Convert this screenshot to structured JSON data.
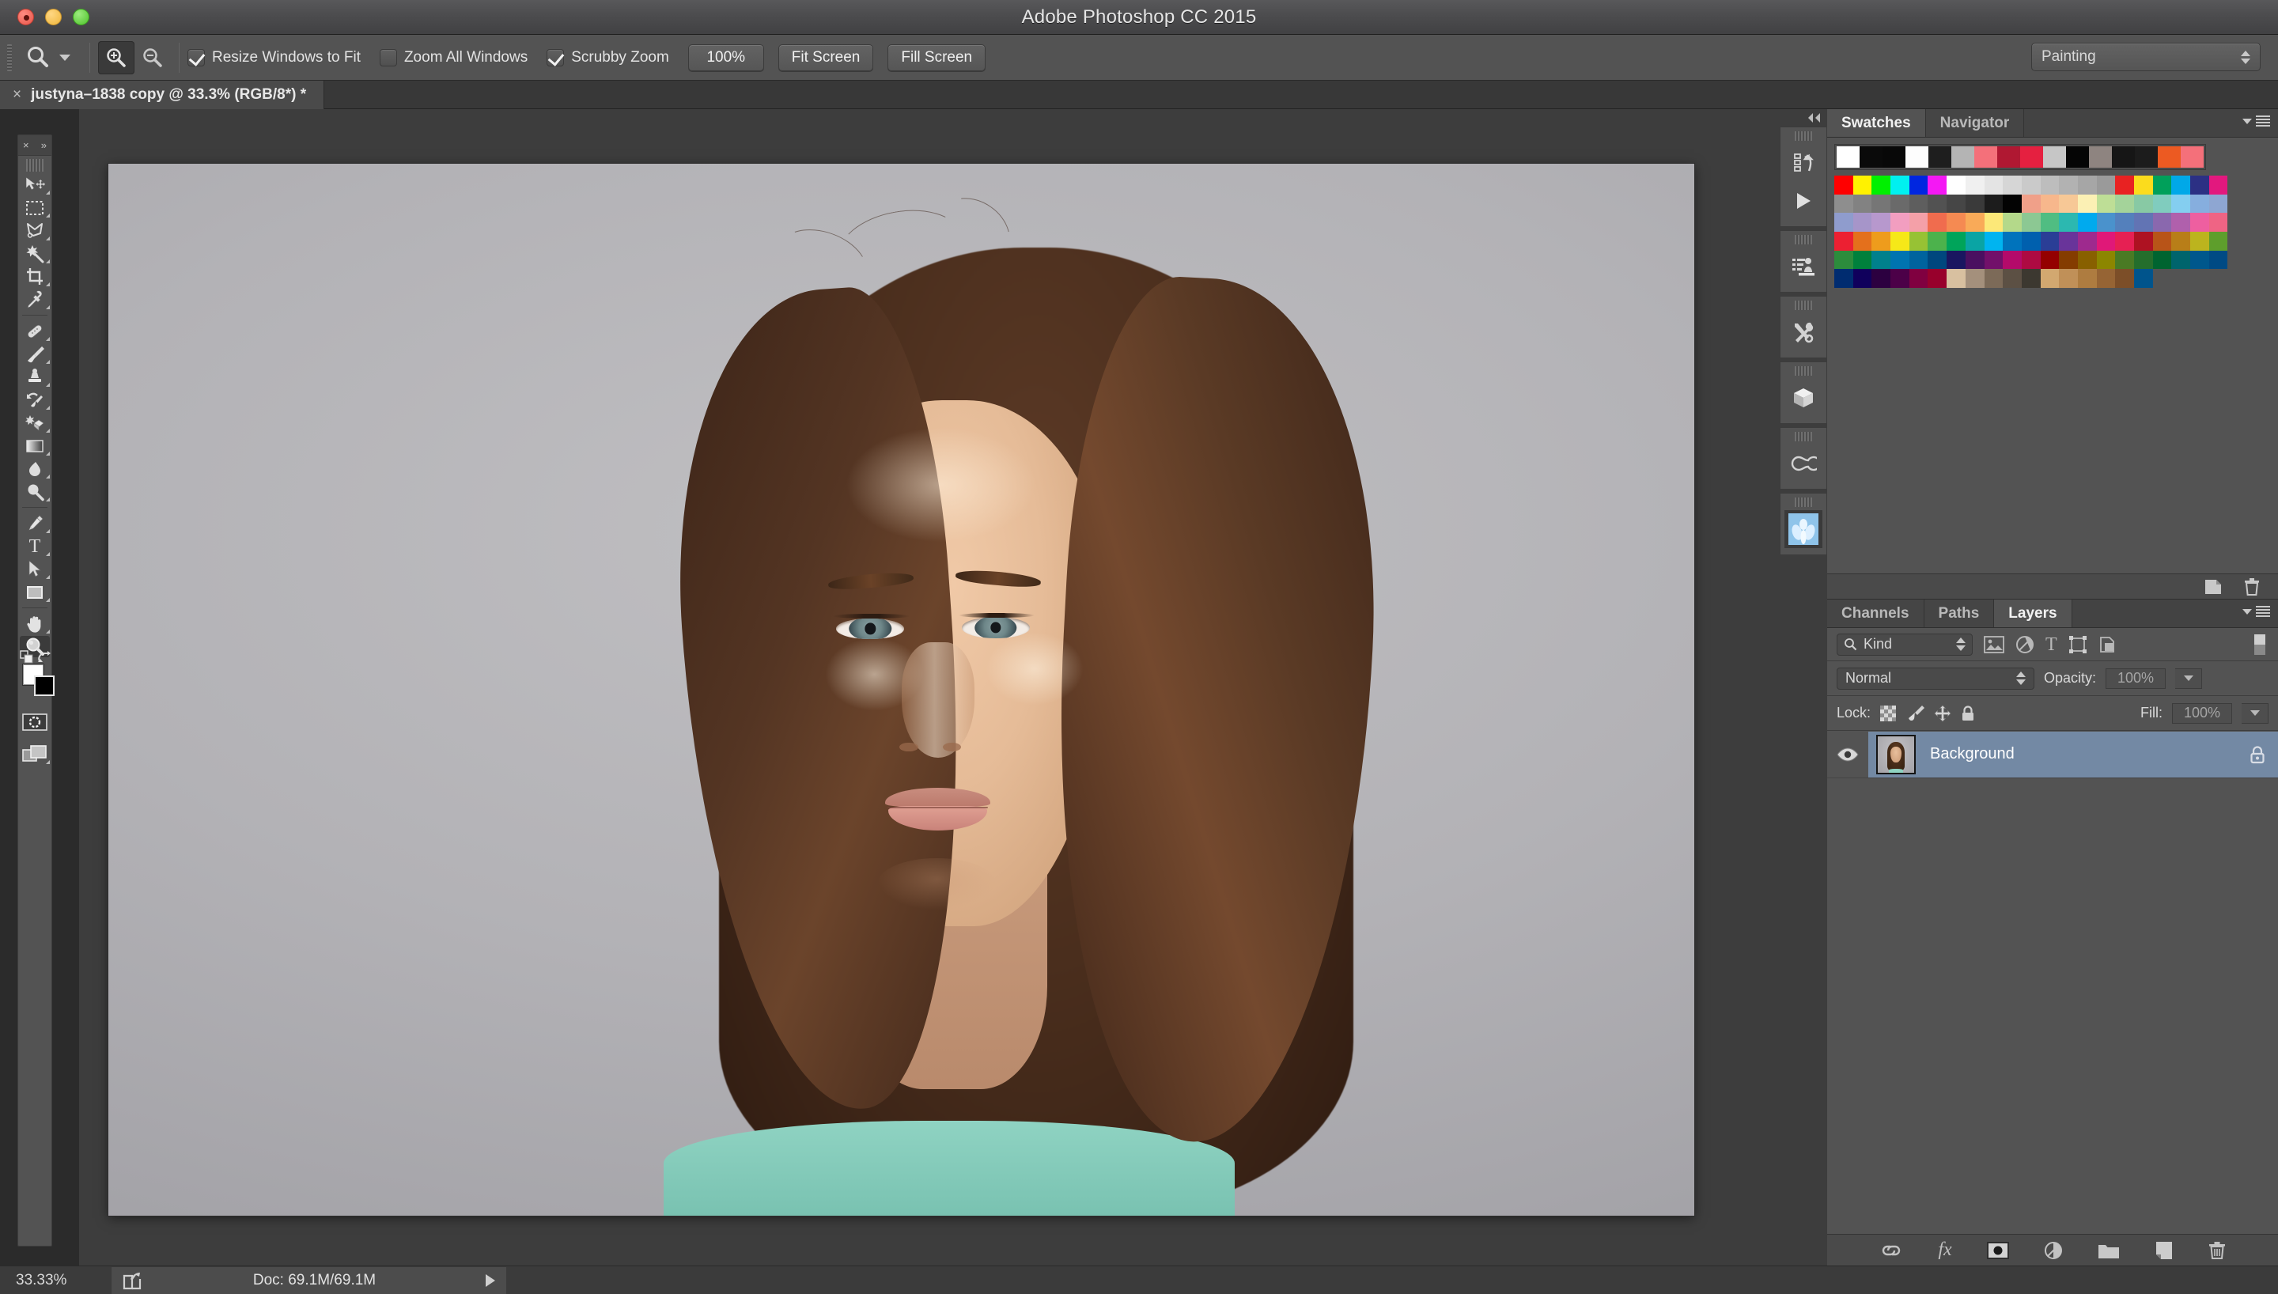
{
  "window": {
    "title": "Adobe Photoshop CC 2015",
    "traffic": {
      "close": "close-button",
      "minimize": "minimize-button",
      "maximize": "maximize-button"
    }
  },
  "options_bar": {
    "tool_preset_icon": "zoom-tool-icon",
    "zoom_in_icon": "zoom-in-icon",
    "zoom_out_icon": "zoom-out-icon",
    "checkboxes": [
      {
        "label": "Resize Windows to Fit",
        "checked": true
      },
      {
        "label": "Zoom All Windows",
        "checked": false
      },
      {
        "label": "Scrubby Zoom",
        "checked": true
      }
    ],
    "buttons": [
      "100%",
      "Fit Screen",
      "Fill Screen"
    ],
    "workspace": "Painting"
  },
  "document_tab": {
    "close": "×",
    "title": "justyna–1838 copy @ 33.3% (RGB/8*) *"
  },
  "toolbar": {
    "close_glyph": "×",
    "expand_glyph": "»",
    "tools": [
      {
        "name": "move-tool",
        "selected": false,
        "has_submenu": true
      },
      {
        "name": "rectangular-marquee-tool",
        "selected": false,
        "has_submenu": true
      },
      {
        "name": "lasso-tool",
        "selected": false,
        "has_submenu": true
      },
      {
        "name": "magic-wand-tool",
        "selected": false,
        "has_submenu": true
      },
      {
        "name": "crop-tool",
        "selected": false,
        "has_submenu": true
      },
      {
        "name": "eyedropper-tool",
        "selected": false,
        "has_submenu": true
      },
      {
        "name": "spot-healing-brush-tool",
        "selected": false,
        "has_submenu": true
      },
      {
        "name": "brush-tool",
        "selected": false,
        "has_submenu": true
      },
      {
        "name": "clone-stamp-tool",
        "selected": false,
        "has_submenu": true
      },
      {
        "name": "history-brush-tool",
        "selected": false,
        "has_submenu": true
      },
      {
        "name": "eraser-tool",
        "selected": false,
        "has_submenu": true
      },
      {
        "name": "gradient-tool",
        "selected": false,
        "has_submenu": true
      },
      {
        "name": "blur-tool",
        "selected": false,
        "has_submenu": true
      },
      {
        "name": "dodge-tool",
        "selected": false,
        "has_submenu": true
      },
      {
        "name": "pen-tool",
        "selected": false,
        "has_submenu": true
      },
      {
        "name": "type-tool",
        "selected": false,
        "has_submenu": true
      },
      {
        "name": "path-selection-tool",
        "selected": false,
        "has_submenu": true
      },
      {
        "name": "rectangle-tool",
        "selected": false,
        "has_submenu": true
      },
      {
        "name": "hand-tool",
        "selected": false,
        "has_submenu": true
      },
      {
        "name": "zoom-tool",
        "selected": true,
        "has_submenu": false
      }
    ],
    "foreground_color": "#ffffff",
    "background_color": "#000000",
    "quick_mask_icon": "quick-mask-icon",
    "screen_mode_icon": "screen-mode-icon"
  },
  "icon_dock": {
    "collapse_glyph": "◀◀",
    "groups": [
      {
        "items": [
          "history-icon",
          "actions-play-icon"
        ]
      },
      {
        "items": [
          "tool-presets-icon"
        ]
      },
      {
        "items": [
          "adjustments-tools-icon"
        ]
      },
      {
        "items": [
          "3d-cube-icon"
        ]
      },
      {
        "items": [
          "creative-cloud-icon"
        ]
      },
      {
        "items": [
          "plugin-panel-icon"
        ]
      }
    ]
  },
  "swatches_panel": {
    "tabs": [
      {
        "label": "Swatches",
        "active": true
      },
      {
        "label": "Navigator",
        "active": false
      }
    ],
    "recent": [
      "#ffffff",
      "#0a0a0a",
      "#080808",
      "#fdfdfd",
      "#1e1e1e",
      "#b4b4b4",
      "#f4707a",
      "#b01832",
      "#e52040",
      "#c6c6c6",
      "#050505",
      "#8e8480",
      "#161616",
      "#1c1c1c",
      "#ec5a22",
      "#f4707a"
    ],
    "grid": [
      "#ff0000",
      "#fff200",
      "#00f000",
      "#00f0f0",
      "#0026e0",
      "#f418f4",
      "#ffffff",
      "#f0f0f0",
      "#e4e4e4",
      "#d6d6d6",
      "#cacaca",
      "#bdbdbd",
      "#b2b2b2",
      "#a6a6a6",
      "#9a9a9a",
      "#e82222",
      "#fbdc1d",
      "#00a05a",
      "#00a8e8",
      "#2c3084",
      "#e2187e",
      "#8e8e8e",
      "#828282",
      "#767676",
      "#6a6a6a",
      "#5e5e5e",
      "#525252",
      "#464646",
      "#3a3a3a",
      "#1c1c1c",
      "#030303",
      "#f0a089",
      "#f7b78c",
      "#f7c896",
      "#fbf0b4",
      "#bede96",
      "#a4d39a",
      "#88c9a4",
      "#80ccbe",
      "#84cef0",
      "#86aede",
      "#8ea6d2",
      "#8f9ccd",
      "#a695c9",
      "#b798cd",
      "#f29ec0",
      "#f4a0a8",
      "#f06c4e",
      "#f58a52",
      "#f9aa58",
      "#fce878",
      "#b4d98a",
      "#8cc893",
      "#50bd82",
      "#2cb8b0",
      "#00aaee",
      "#4a92cc",
      "#5480bc",
      "#6274b4",
      "#8a68ae",
      "#b060ac",
      "#ee5fa0",
      "#ef6484",
      "#ec2032",
      "#e4701c",
      "#ee9c1c",
      "#f6e818",
      "#97c234",
      "#4cb24c",
      "#00a45a",
      "#0aa4a4",
      "#00b4f0",
      "#0073bc",
      "#0060ae",
      "#2a3e96",
      "#69349a",
      "#9e2a8e",
      "#e01878",
      "#e62053",
      "#ae1222",
      "#b85418",
      "#b87e18",
      "#bcb41e",
      "#5e9e2c",
      "#2c8c3c",
      "#00803c",
      "#00808c",
      "#0074b0",
      "#00639e",
      "#00477e",
      "#1a1660",
      "#4a1060",
      "#72106a",
      "#b40a6a",
      "#ae0a42",
      "#940000",
      "#843c00",
      "#886000",
      "#8c8600",
      "#4a7a24",
      "#246e2c",
      "#006430",
      "#00646c",
      "#00578c",
      "#004a84",
      "#002c70",
      "#10005c",
      "#2c0040",
      "#4c0048",
      "#800040",
      "#98002c",
      "#d8c0a0",
      "#a4907c",
      "#7c6a58",
      "#5c5044",
      "#3c3830",
      "#d2a870",
      "#c09058",
      "#ae7c40",
      "#966434",
      "#7c4e28",
      "#00548c"
    ],
    "footer_icons": [
      "new-swatch-icon",
      "delete-swatch-icon"
    ]
  },
  "layers_panel": {
    "tabs": [
      {
        "label": "Channels",
        "active": false
      },
      {
        "label": "Paths",
        "active": false
      },
      {
        "label": "Layers",
        "active": true
      }
    ],
    "filter": {
      "kind_label": "Kind",
      "filter_icons": [
        "pixel-filter-icon",
        "adjustment-filter-icon",
        "type-filter-icon",
        "shape-filter-icon",
        "smart-object-filter-icon"
      ]
    },
    "blend_mode": "Normal",
    "opacity_label": "Opacity:",
    "opacity_value": "100%",
    "lock_label": "Lock:",
    "lock_icons": [
      "lock-transparent-pixels-icon",
      "lock-image-pixels-icon",
      "lock-position-icon",
      "lock-all-icon"
    ],
    "fill_label": "Fill:",
    "fill_value": "100%",
    "layers": [
      {
        "name": "Background",
        "visible": true,
        "locked": true,
        "selected": true
      }
    ],
    "footer_icons": [
      "link-layers-icon",
      "layer-style-fx-icon",
      "layer-mask-icon",
      "adjustment-layer-icon",
      "new-group-icon",
      "new-layer-icon",
      "delete-layer-icon"
    ],
    "selection_color": "#7389a4"
  },
  "status_bar": {
    "zoom": "33.33%",
    "share_icon": "share-icon",
    "doc_info": "Doc: 69.1M/69.1M",
    "expand_icon": "expand-arrow-icon"
  },
  "canvas": {
    "document_name": "justyna-1838 copy",
    "zoom_percent": "33.3%",
    "color_mode": "RGB/8*",
    "image_description": "portrait-photograph-of-woman"
  },
  "colors": {
    "chrome": "#535353",
    "panel_bg": "#3b3b3b",
    "canvas_bg": "#3d3d3d",
    "accent_selection": "#7389a4",
    "text": "#e3e3e3"
  }
}
